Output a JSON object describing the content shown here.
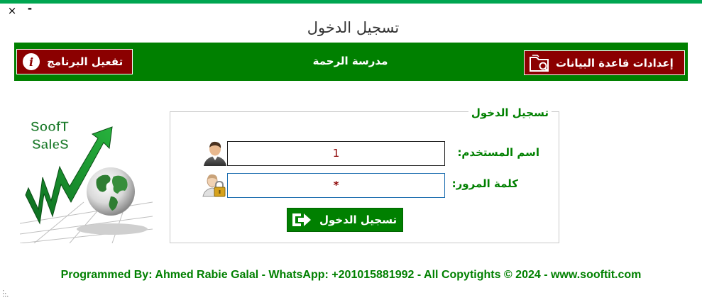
{
  "window": {
    "title": "تسجيل الدخول",
    "close_glyph": "×",
    "minimize_glyph": "-"
  },
  "header": {
    "activate_label": "تفعيل البرنامج",
    "activate_icon": "info-icon",
    "school_name": "مدرسة الرحمة",
    "db_settings_label": "إعدادات قاعدة البيانات",
    "db_settings_icon": "folder-search-icon"
  },
  "logo": {
    "line1": "SoofT",
    "line2": "SaleS"
  },
  "login": {
    "legend": "تسجيل الدخول",
    "username_label": "اسم المستخدم:",
    "username_value": "1",
    "username_icon": "user-icon",
    "password_label": "كلمة المرور:",
    "password_value": "*",
    "password_icon": "user-lock-icon",
    "submit_label": "تسجيل الدخول",
    "submit_icon": "login-arrow-icon"
  },
  "footer": {
    "text": "Programmed By: Ahmed Rabie Galal - WhatsApp: +201015881992 - All Copytights © 2024 - www.sooftit.com"
  },
  "colors": {
    "accent_green": "#008000",
    "top_bar_green": "#00a651",
    "button_red": "#8b0000",
    "input_text": "#8b0000",
    "focus_border": "#1e6fb0"
  }
}
